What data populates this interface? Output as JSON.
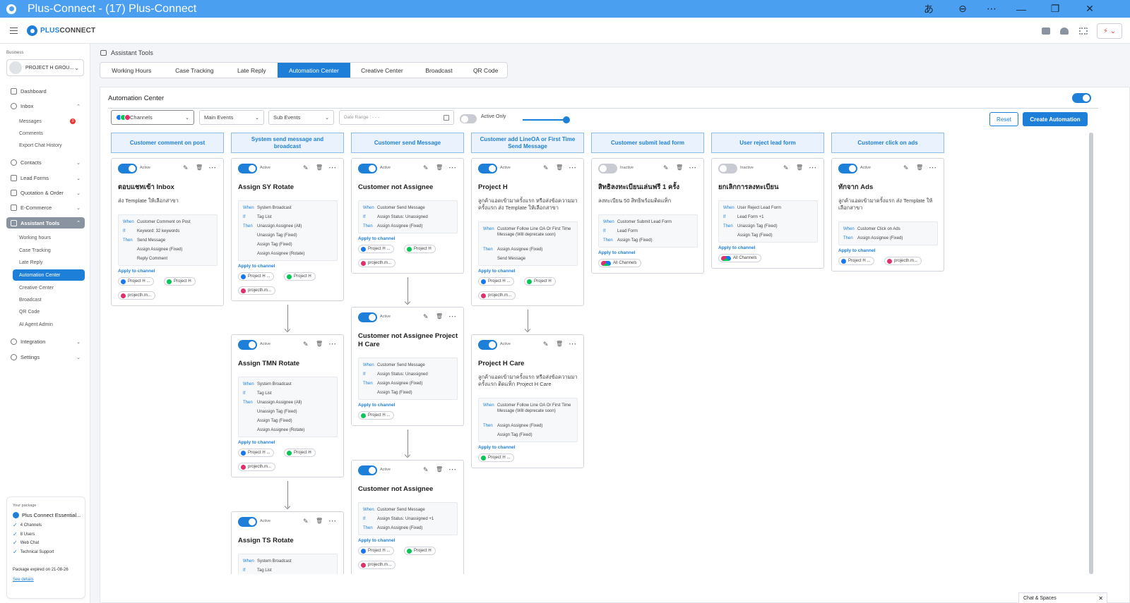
{
  "window": {
    "title": "Plus-Connect - (17) Plus-Connect"
  },
  "brand": {
    "name_a": "PLUS",
    "name_b": "CONNECT",
    "accent": "#1e7fd8",
    "titlebar": "#4a9ff0"
  },
  "sidebar": {
    "business_label": "Business",
    "business_name": "PROJECT H GROU...",
    "items": {
      "dashboard": "Dashboard",
      "inbox": "Inbox",
      "messages": "Messages",
      "messages_badge": "3",
      "comments": "Comments",
      "export": "Export Chat History",
      "contacts": "Contacts",
      "lead_forms": "Lead Forms",
      "quotation": "Quotation & Order",
      "ecommerce": "E-Commerce",
      "assistant": "Assistant Tools",
      "working_hours": "Working hours",
      "case_tracking": "Case Tracking",
      "late_reply": "Late Reply",
      "automation": "Automation Center",
      "creative": "Creative Center",
      "broadcast": "Broadcast",
      "qr": "QR Code",
      "ai_agent": "AI Agent Admin",
      "integration": "Integration",
      "settings": "Settings"
    },
    "package": {
      "label": "Your package",
      "name": "Plus Connect Essential...",
      "features": [
        "4 Channels",
        "8 Users",
        "Web Chat",
        "Technical Support"
      ],
      "expires": "Package expired on 21-08-26",
      "see_details": "See details"
    }
  },
  "page": {
    "title": "Assistant Tools"
  },
  "tabs": [
    "Working Hours",
    "Case Tracking",
    "Late Reply",
    "Automation Center",
    "Creative Center",
    "Broadcast",
    "QR Code"
  ],
  "panel": {
    "title": "Automation Center",
    "filters": {
      "channels": "Channels",
      "main_events": "Main Events",
      "sub_events": "Sub Events",
      "date_range": "Date Range : - - -",
      "active_only": "Active Only"
    },
    "reset": "Reset",
    "create": "Create Automation"
  },
  "columns": [
    {
      "header": "Customer comment on post",
      "cards": [
        {
          "status": "Active",
          "on": true,
          "title": "ตอบแชทเข้า Inbox",
          "desc": "ส่ง Template ให้เลือกสาขา",
          "rules": [
            [
              "When",
              "Customer Comment on Post"
            ],
            [
              "If",
              "Keyword: 32 keywords"
            ],
            [
              "Then",
              "Send Message"
            ],
            [
              "",
              "Assign Assignee (Fixed)"
            ],
            [
              "",
              "Reply Comment"
            ]
          ],
          "apply": "Apply to channel",
          "channels": [
            [
              "f",
              "Project H ..."
            ],
            [
              "l",
              "Project H"
            ],
            [
              "i",
              "projecth.m..."
            ]
          ]
        }
      ]
    },
    {
      "header": "System send message and broadcast",
      "cards": [
        {
          "status": "Active",
          "on": true,
          "title": "Assign SY Rotate",
          "desc": "",
          "rules": [
            [
              "When",
              "System Broadcast"
            ],
            [
              "If",
              "Tag List"
            ],
            [
              "Then",
              "Unassign Assignee (All)"
            ],
            [
              "",
              "Unassign Tag (Fixed)"
            ],
            [
              "",
              "Assign Tag (Fixed)"
            ],
            [
              "",
              "Assign Assignee (Rotate)"
            ]
          ],
          "apply": "Apply to channel",
          "channels": [
            [
              "f",
              "Project H ..."
            ],
            [
              "l",
              "Project H"
            ],
            [
              "i",
              "projecth.m..."
            ]
          ]
        },
        {
          "status": "Active",
          "on": true,
          "title": "Assign TMN Rotate",
          "desc": "",
          "rules": [
            [
              "When",
              "System Broadcast"
            ],
            [
              "If",
              "Tag List"
            ],
            [
              "Then",
              "Unassign Assignee (All)"
            ],
            [
              "",
              "Unassign Tag (Fixed)"
            ],
            [
              "",
              "Assign Tag (Fixed)"
            ],
            [
              "",
              "Assign Assignee (Rotate)"
            ]
          ],
          "apply": "Apply to channel",
          "channels": [
            [
              "f",
              "Project H ..."
            ],
            [
              "l",
              "Project H"
            ],
            [
              "i",
              "projecth.m..."
            ]
          ]
        },
        {
          "status": "Active",
          "on": true,
          "title": "Assign TS Rotate",
          "desc": "",
          "rules": [
            [
              "When",
              "System Broadcast"
            ],
            [
              "If",
              "Tag List"
            ]
          ],
          "apply": "",
          "channels": []
        }
      ]
    },
    {
      "header": "Customer send Message",
      "cards": [
        {
          "status": "Active",
          "on": true,
          "title": "Customer not Assignee",
          "desc": "",
          "rules": [
            [
              "When",
              "Customer Send Message"
            ],
            [
              "If",
              "Assign Status: Unassigned"
            ],
            [
              "Then",
              "Assign Assignee (Fixed)"
            ]
          ],
          "apply": "Apply to channel",
          "channels": [
            [
              "f",
              "Project H ..."
            ],
            [
              "l",
              "Project H"
            ],
            [
              "i",
              "projecth.m..."
            ]
          ]
        },
        {
          "status": "Active",
          "on": true,
          "title": "Customer not Assignee Project H Care",
          "desc": "",
          "rules": [
            [
              "When",
              "Customer Send Message"
            ],
            [
              "If",
              "Assign Status: Unassigned"
            ],
            [
              "Then",
              "Assign Assignee (Fixed)"
            ],
            [
              "",
              "Assign Tag (Fixed)"
            ]
          ],
          "apply": "Apply to channel",
          "channels": [
            [
              "l",
              "Project H ..."
            ]
          ]
        },
        {
          "status": "Active",
          "on": true,
          "title": "Customer not Assignee",
          "desc": "",
          "rules": [
            [
              "When",
              "Customer Send Message"
            ],
            [
              "If",
              "Assign Status: Unassigned +1"
            ],
            [
              "Then",
              "Assign Assignee (Fixed)"
            ]
          ],
          "apply": "Apply to channel",
          "channels": [
            [
              "f",
              "Project H ..."
            ],
            [
              "l",
              "Project H"
            ],
            [
              "i",
              "projecth.m..."
            ]
          ]
        }
      ]
    },
    {
      "header": "Customer add LineOA or First Time Send Message",
      "cards": [
        {
          "status": "Active",
          "on": true,
          "title": "Project H",
          "desc": "ลูกค้าแอดเข้ามาครั้งแรก หรือส่งข้อความมาครั้งแรก  ส่ง Template ให้เลือกสาขา",
          "rules": [
            [
              "When",
              "Customer Follow Line OA Or First Time Message (Will deprecate soon)"
            ],
            [
              "Then",
              "Assign Assignee (Fixed)"
            ],
            [
              "",
              "Send Message"
            ]
          ],
          "apply": "Apply to channel",
          "channels": [
            [
              "f",
              "Project H ..."
            ],
            [
              "l",
              "Project H"
            ],
            [
              "i",
              "projecth.m..."
            ]
          ]
        },
        {
          "status": "Active",
          "on": true,
          "title": "Project H Care",
          "desc": "ลูกค้าแอดเข้ามาครั้งแรก หรือส่งข้อความมาครั้งแรก  ติดแท็ก Project H Care",
          "rules": [
            [
              "When",
              "Customer Follow Line OA Or First Time Message (Will deprecate soon)"
            ],
            [
              "Then",
              "Assign Assignee (Fixed)"
            ],
            [
              "",
              "Assign Tag (Fixed)"
            ]
          ],
          "apply": "Apply to channel",
          "channels": [
            [
              "l",
              "Project H ..."
            ]
          ]
        }
      ]
    },
    {
      "header": "Customer submit lead form",
      "cards": [
        {
          "status": "Inactive",
          "on": false,
          "title": "สิทธิลงทะเบียนเล่นฟรี 1 ครั้ง",
          "desc": "ลงทะเบียน 50 สิทธิพร้อมติดแท็ก",
          "rules": [
            [
              "When",
              "Customer Submit Lead Form"
            ],
            [
              "If",
              "Lead Form"
            ],
            [
              "Then",
              "Assign Tag (Fixed)"
            ]
          ],
          "apply": "Apply to channel",
          "channels": [
            [
              "m",
              "All Channels"
            ]
          ]
        }
      ]
    },
    {
      "header": "User reject lead form",
      "cards": [
        {
          "status": "Inactive",
          "on": false,
          "title": "ยกเลิกการลงทะเบียน",
          "desc": "",
          "rules": [
            [
              "When",
              "User Reject Lead Form"
            ],
            [
              "If",
              "Lead Form +1"
            ],
            [
              "Then",
              "Unassign Tag (Fixed)"
            ],
            [
              "",
              "Assign Tag (Fixed)"
            ]
          ],
          "apply": "Apply to channel",
          "channels": [
            [
              "m",
              "All Channels"
            ]
          ]
        }
      ]
    },
    {
      "header": "Customer click on ads",
      "cards": [
        {
          "status": "Active",
          "on": true,
          "title": "ทักจาก Ads",
          "desc": "ลูกค้าแอดเข้ามาครั้งแรก ส่ง Template ให้เลือกสาขา",
          "rules": [
            [
              "When",
              "Customer Click on Ads"
            ],
            [
              "Then",
              "Assign Assignee (Fixed)"
            ]
          ],
          "apply": "Apply to channel",
          "channels": [
            [
              "f",
              "Project H ..."
            ],
            [
              "i",
              "projecth.m..."
            ]
          ]
        }
      ]
    }
  ],
  "chat_spaces": "Chat & Spaces",
  "channel_colors": {
    "f": "#1877f2",
    "l": "#06c755",
    "i": "#e1306c"
  }
}
